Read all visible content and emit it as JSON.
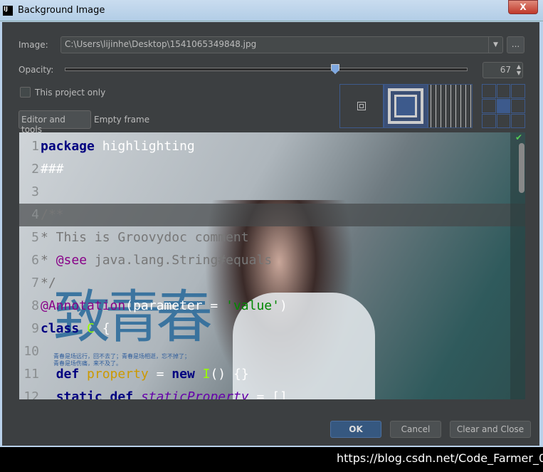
{
  "window": {
    "title": "Background Image",
    "app_icon": "IJ",
    "close": "X"
  },
  "image": {
    "label": "Image:",
    "path": "C:\\Users\\lijinhe\\Desktop\\1541065349848.jpg",
    "browse": "..."
  },
  "opacity": {
    "label": "Opacity:",
    "value": 67,
    "percent": 67
  },
  "this_project_only": {
    "label": "This project only",
    "checked": false
  },
  "targets": {
    "tabs": [
      "Editor and tools",
      "Empty frame"
    ],
    "selected": "Editor and tools"
  },
  "fill_mode": {
    "options": [
      "center",
      "scale",
      "tile"
    ],
    "selected": "scale"
  },
  "anchor": {
    "selected": "center"
  },
  "preview": {
    "lines": [
      {
        "n": "1",
        "parts": [
          [
            "kw",
            "package"
          ],
          [
            "w",
            " highlighting"
          ]
        ]
      },
      {
        "n": "2",
        "parts": [
          [
            "w",
            "###"
          ]
        ]
      },
      {
        "n": "3",
        "parts": []
      },
      {
        "n": "4",
        "parts": [
          [
            "cm",
            "/**"
          ]
        ]
      },
      {
        "n": "5",
        "parts": [
          [
            "cm",
            "* This is Groovydoc comment"
          ]
        ]
      },
      {
        "n": "6",
        "parts": [
          [
            "cm",
            "* "
          ],
          [
            "ann",
            "@see"
          ],
          [
            "cm",
            " java.lang.String#equals"
          ]
        ]
      },
      {
        "n": "7",
        "parts": [
          [
            "cm",
            "*/"
          ]
        ]
      },
      {
        "n": "8",
        "parts": [
          [
            "ann",
            "@Annotation"
          ],
          [
            "w",
            "(parameter = "
          ],
          [
            "str",
            "'value'"
          ],
          [
            "w",
            ")"
          ]
        ]
      },
      {
        "n": "9",
        "parts": [
          [
            "kw",
            "class "
          ],
          [
            "cl",
            "C"
          ],
          [
            "w",
            " {"
          ]
        ]
      },
      {
        "n": "10",
        "parts": []
      },
      {
        "n": "11",
        "parts": [
          [
            "w",
            "  "
          ],
          [
            "kw",
            "def "
          ],
          [
            "fld",
            "property"
          ],
          [
            "w",
            " = "
          ],
          [
            "kw",
            "new "
          ],
          [
            "cl",
            "I"
          ],
          [
            "w",
            "() {}"
          ]
        ]
      },
      {
        "n": "12",
        "parts": [
          [
            "w",
            "  "
          ],
          [
            "kw",
            "static def "
          ],
          [
            "sp",
            "staticProperty"
          ],
          [
            "w",
            " = []"
          ]
        ]
      }
    ],
    "image_text": {
      "title": "致青春",
      "line1": "青春是场远行，回不去了；青春是场相逝，忘不掉了；",
      "line2": "青春是场伤痛，来不及了。"
    }
  },
  "buttons": {
    "ok": "OK",
    "cancel": "Cancel",
    "clear": "Clear and Close"
  },
  "watermark": "https://blog.csdn.net/Code_Farmer_007"
}
